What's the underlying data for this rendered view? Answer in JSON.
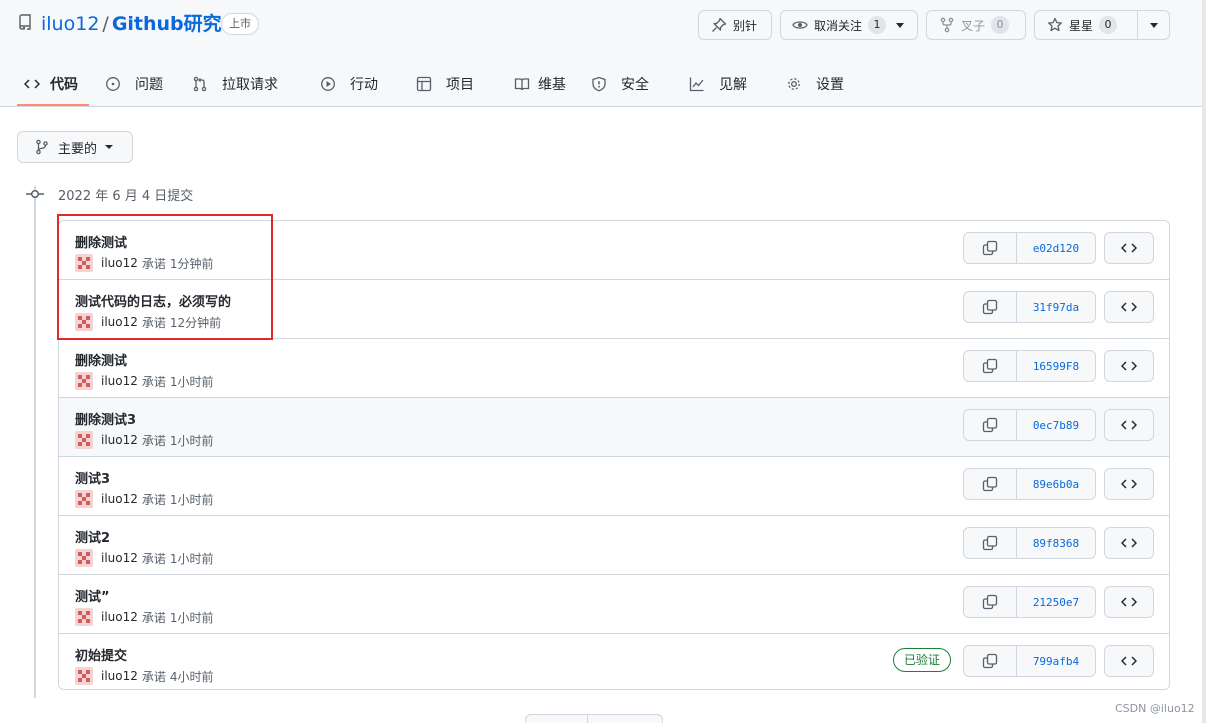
{
  "repo": {
    "owner": "iluo12",
    "separator": "/",
    "name": "Github研究",
    "visibility": "上市"
  },
  "actions": {
    "pin": "别针",
    "watch": {
      "label": "取消关注",
      "count": "1"
    },
    "fork": {
      "label": "叉子",
      "count": "0"
    },
    "star": {
      "label": "星星",
      "count": "0"
    }
  },
  "tabs": [
    {
      "label": "代码",
      "icon": "code-icon",
      "active": true
    },
    {
      "label": "问题",
      "icon": "issue-icon"
    },
    {
      "label": "拉取请求",
      "icon": "pull-request-icon"
    },
    {
      "label": "行动",
      "icon": "play-icon"
    },
    {
      "label": "项目",
      "icon": "table-icon"
    },
    {
      "label": "维基",
      "icon": "book-icon"
    },
    {
      "label": "安全",
      "icon": "shield-icon"
    },
    {
      "label": "见解",
      "icon": "graph-icon"
    },
    {
      "label": "设置",
      "icon": "gear-icon"
    }
  ],
  "branch": {
    "label": "主要的"
  },
  "commit_group": {
    "title": "2022 年 6 月 4 日提交"
  },
  "commits": [
    {
      "title": "删除测试",
      "author": "iluo12",
      "action": "承诺",
      "time": "1分钟前",
      "sha": "e02d120"
    },
    {
      "title": "测试代码的日志，必须写的",
      "author": "iluo12",
      "action": "承诺",
      "time": "12分钟前",
      "sha": "31f97da"
    },
    {
      "title": "删除测试",
      "author": "iluo12",
      "action": "承诺",
      "time": "1小时前",
      "sha": "16599F8"
    },
    {
      "title": "删除测试3",
      "author": "iluo12",
      "action": "承诺",
      "time": "1小时前",
      "sha": "0ec7b89"
    },
    {
      "title": "测试3",
      "author": "iluo12",
      "action": "承诺",
      "time": "1小时前",
      "sha": "89e6b0a"
    },
    {
      "title": "测试2",
      "author": "iluo12",
      "action": "承诺",
      "time": "1小时前",
      "sha": "89f8368"
    },
    {
      "title": "测试”",
      "author": "iluo12",
      "action": "承诺",
      "time": "1小时前",
      "sha": "21250e7"
    },
    {
      "title": "初始提交",
      "author": "iluo12",
      "action": "承诺",
      "time": "4小时前",
      "sha": "799afb4",
      "verified": "已验证"
    }
  ],
  "watermark": "CSDN @iluo12",
  "colors": {
    "link": "#0969da",
    "verified": "#1a7f37",
    "annotation": "#e02a2a",
    "tab_underline": "#fd8c73"
  }
}
